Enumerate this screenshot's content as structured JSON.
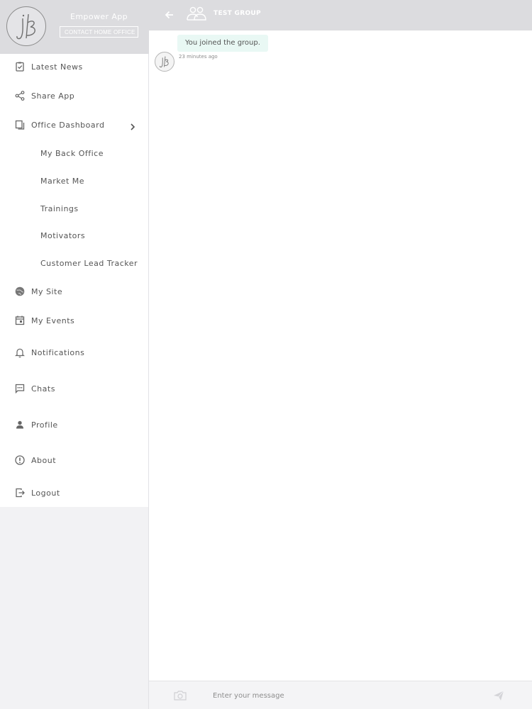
{
  "sidebar": {
    "app_name": "Empower App",
    "contact_label": "CONTACT HOME OFFICE",
    "items": [
      {
        "label": "Latest News",
        "icon": "clipboard-check-icon"
      },
      {
        "label": "Share App",
        "icon": "share-icon"
      },
      {
        "label": "Office Dashboard",
        "icon": "copy-icon"
      },
      {
        "label": "My Back Office"
      },
      {
        "label": "Market Me"
      },
      {
        "label": "Trainings"
      },
      {
        "label": "Motivators"
      },
      {
        "label": "Customer Lead Tracker"
      },
      {
        "label": "My Site",
        "icon": "globe-icon"
      },
      {
        "label": "My Events",
        "icon": "calendar-icon"
      },
      {
        "label": "Notifications",
        "icon": "bell-icon"
      },
      {
        "label": "Chats",
        "icon": "chat-icon"
      },
      {
        "label": "Profile",
        "icon": "user-icon"
      },
      {
        "label": "About",
        "icon": "info-icon"
      },
      {
        "label": "Logout",
        "icon": "logout-icon"
      }
    ]
  },
  "header": {
    "title": "TEST GROUP"
  },
  "chat": {
    "messages": [
      {
        "text": "You joined the group.",
        "time": "23 minutes ago"
      }
    ]
  },
  "composer": {
    "placeholder": "Enter your message"
  },
  "colors": {
    "header_bg": "#dcdcdf",
    "sidebar_bg": "#f2f2f4",
    "bubble_bg": "#e9f8f4"
  }
}
